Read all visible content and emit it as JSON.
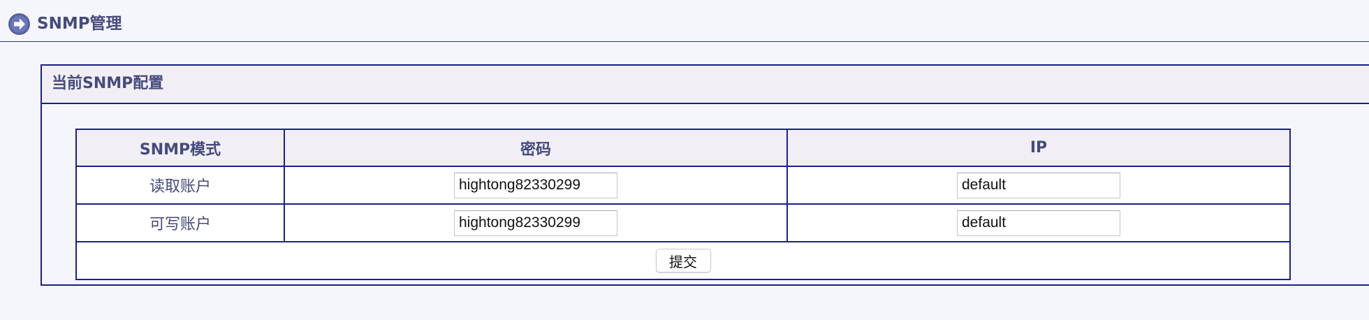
{
  "page": {
    "title": "SNMP管理",
    "icon": "arrow-circle-right-icon"
  },
  "panel": {
    "title": "当前SNMP配置"
  },
  "table": {
    "headers": [
      "SNMP模式",
      "密码",
      "IP"
    ],
    "rows": [
      {
        "mode": "读取账户",
        "password": "hightong82330299",
        "ip": "default"
      },
      {
        "mode": "可写账户",
        "password": "hightong82330299",
        "ip": "default"
      }
    ],
    "submit_label": "提交"
  },
  "colors": {
    "accent": "#1e1f8a",
    "text": "#464a7c",
    "header_bg": "#f1eef5",
    "page_bg": "#f5f6fb"
  }
}
